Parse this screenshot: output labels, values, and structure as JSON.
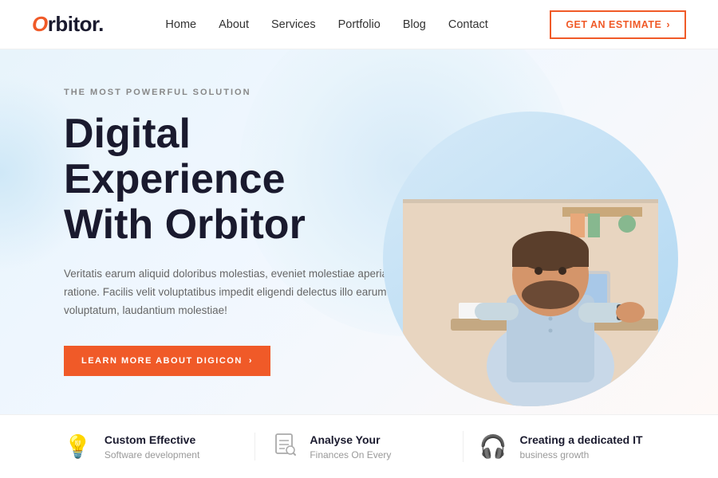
{
  "navbar": {
    "logo_prefix": "O",
    "logo_text": "rbitor.",
    "links": [
      {
        "label": "Home",
        "id": "home"
      },
      {
        "label": "About",
        "id": "about"
      },
      {
        "label": "Services",
        "id": "services"
      },
      {
        "label": "Portfolio",
        "id": "portfolio"
      },
      {
        "label": "Blog",
        "id": "blog"
      },
      {
        "label": "Contact",
        "id": "contact"
      }
    ],
    "cta_label": "GET AN ESTIMATE",
    "cta_arrow": "›"
  },
  "hero": {
    "subtitle": "THE MOST POWERFUL SOLUTION",
    "title_line1": "Digital Experience",
    "title_line2": "With Orbitor",
    "description": "Veritatis earum aliquid doloribus molestias, eveniet molestiae aperiam ratione. Facilis velit voluptatibus impedit eligendi delectus illo earum voluptatum, laudantium molestiae!",
    "cta_label": "LEARN MORE ABOUT DIGICON",
    "cta_arrow": "›"
  },
  "bottom_cards": [
    {
      "icon": "💡",
      "title": "Custom Effective",
      "subtitle": "Software development"
    },
    {
      "icon": "⚙",
      "title": "Analyse Your",
      "subtitle": "Finances On Every"
    },
    {
      "icon": "🎧",
      "title": "Creating a dedicated IT",
      "subtitle": "business growth"
    }
  ]
}
